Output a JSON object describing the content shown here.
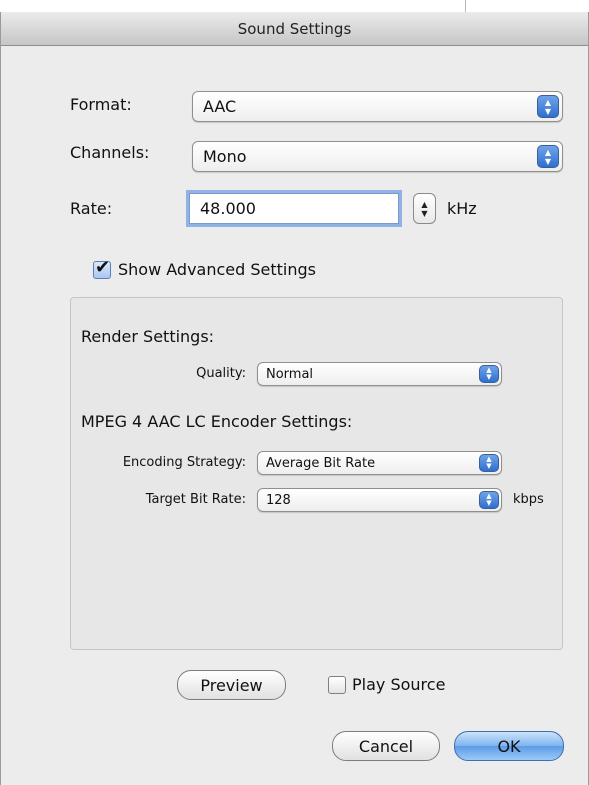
{
  "window": {
    "title": "Sound Settings"
  },
  "format": {
    "label": "Format:",
    "value": "AAC"
  },
  "channels": {
    "label": "Channels:",
    "value": "Mono"
  },
  "rate": {
    "label": "Rate:",
    "value": "48.000",
    "unit": "kHz"
  },
  "advanced": {
    "label": "Show Advanced Settings",
    "checked": true
  },
  "render": {
    "heading": "Render Settings:",
    "quality_label": "Quality:",
    "quality_value": "Normal"
  },
  "encoder": {
    "heading": "MPEG 4 AAC LC Encoder Settings:",
    "strategy_label": "Encoding Strategy:",
    "strategy_value": "Average Bit Rate",
    "bitrate_label": "Target Bit Rate:",
    "bitrate_value": "128",
    "bitrate_unit": "kbps"
  },
  "footer": {
    "preview_label": "Preview",
    "play_source_label": "Play Source",
    "play_source_checked": false,
    "cancel_label": "Cancel",
    "ok_label": "OK"
  },
  "colors": {
    "accent": "#3a7fd8",
    "window_bg": "#ececec",
    "focus_ring": "#8fb3e6"
  },
  "icons": {
    "popup_arrows": "up-down-arrows-icon",
    "stepper": "stepper-icon",
    "checkmark": "checkmark-icon"
  }
}
